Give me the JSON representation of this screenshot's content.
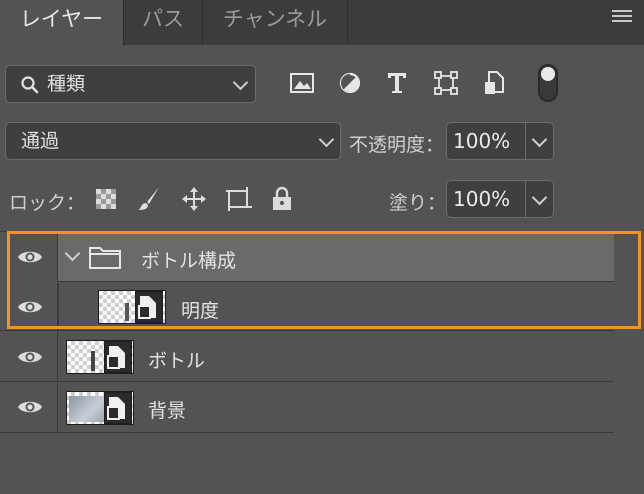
{
  "tabs": [
    {
      "label": "レイヤー",
      "active": true
    },
    {
      "label": "パス",
      "active": false
    },
    {
      "label": "チャンネル",
      "active": false
    }
  ],
  "filter": {
    "value": "種類",
    "icons": [
      "image-filter-icon",
      "adjustment-filter-icon",
      "type-filter-icon",
      "shape-filter-icon",
      "smart-object-filter-icon",
      "filter-toggle"
    ]
  },
  "blend": {
    "value": "通過",
    "opacity_label": "不透明度：",
    "opacity_value": "100%"
  },
  "lock": {
    "label": "ロック：",
    "fill_label": "塗り：",
    "fill_value": "100%"
  },
  "layers": [
    {
      "name": "ボトル構成",
      "type": "group",
      "expanded": true,
      "visible": true,
      "selected": true
    },
    {
      "name": "明度",
      "type": "smart-object",
      "visible": true,
      "indent": true
    },
    {
      "name": "ボトル",
      "type": "smart-object",
      "visible": true
    },
    {
      "name": "背景",
      "type": "smart-object",
      "visible": true
    }
  ],
  "colors": {
    "highlight": "#f7931e",
    "panel": "#535353",
    "selected_row": "#6a6a6a"
  }
}
